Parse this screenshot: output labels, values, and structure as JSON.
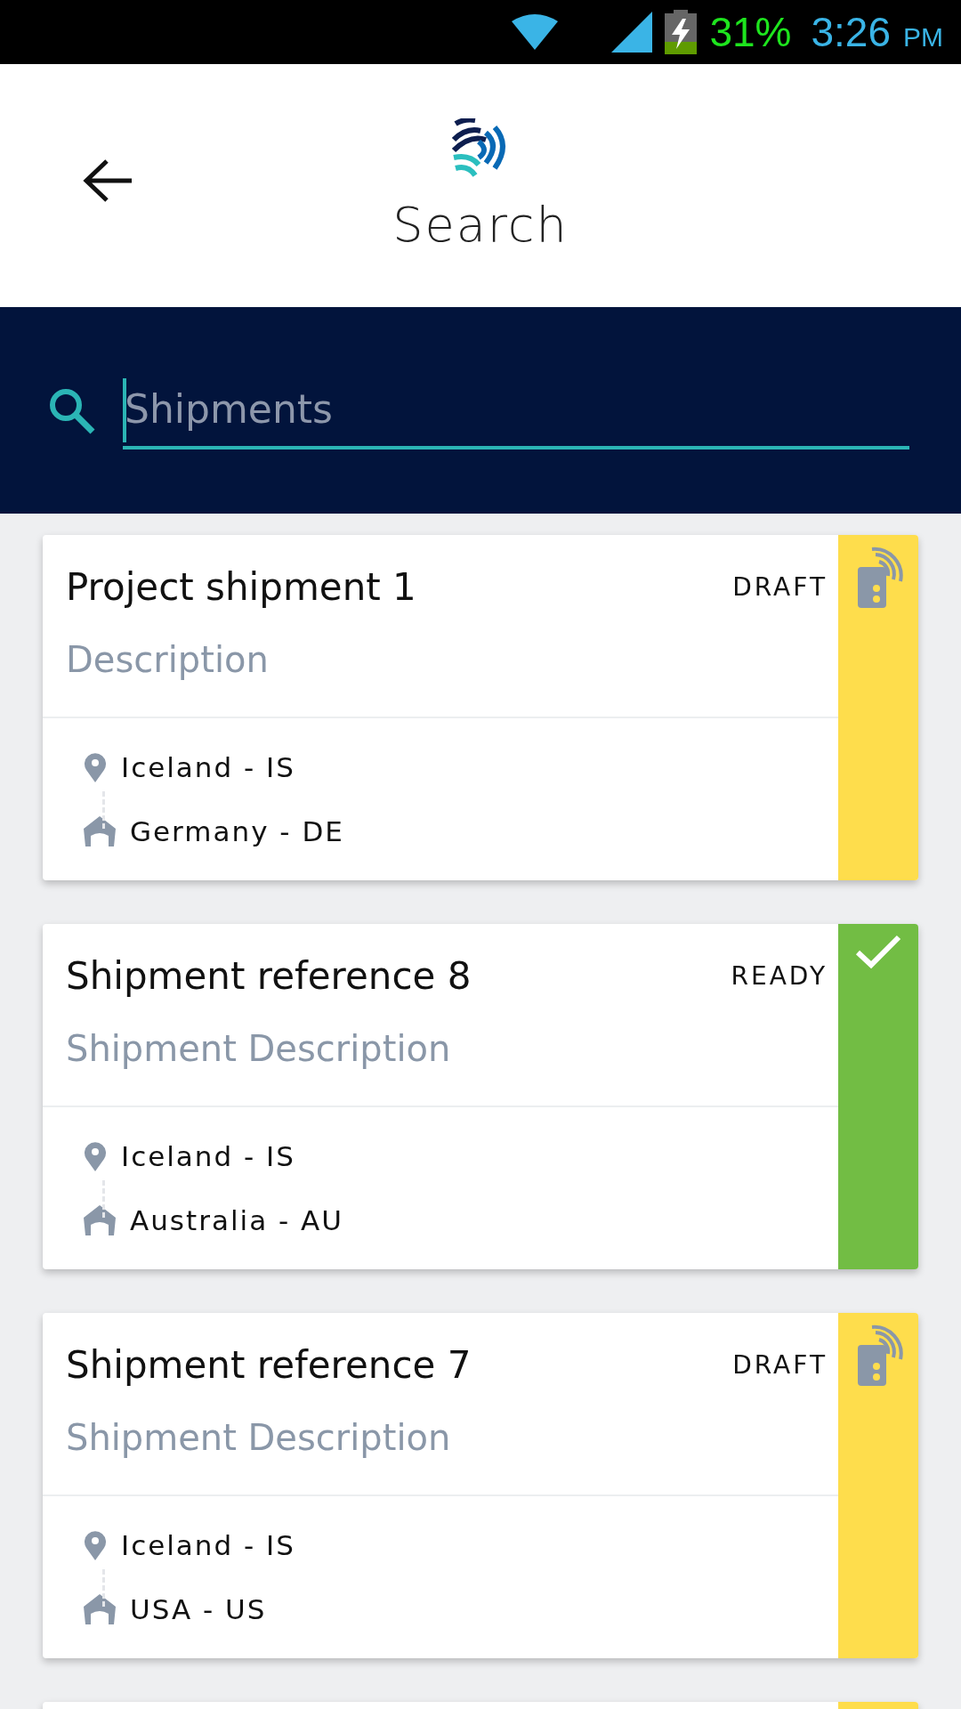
{
  "status_bar": {
    "battery": "31%",
    "time": "3:26",
    "ampm": "PM"
  },
  "header": {
    "title": "Search"
  },
  "search": {
    "placeholder": "Shipments"
  },
  "cards": [
    {
      "kind": "draft",
      "title": "Project shipment 1",
      "status": "DRAFT",
      "description": "Description",
      "origin": "Iceland - IS",
      "destination": "Germany - DE"
    },
    {
      "kind": "ready",
      "title": "Shipment reference 8",
      "status": "READY",
      "description": "Shipment Description",
      "origin": "Iceland - IS",
      "destination": "Australia - AU"
    },
    {
      "kind": "draft",
      "title": "Shipment reference 7",
      "status": "DRAFT",
      "description": "Shipment Description",
      "origin": "Iceland - IS",
      "destination": "USA - US"
    },
    {
      "kind": "draft"
    }
  ]
}
